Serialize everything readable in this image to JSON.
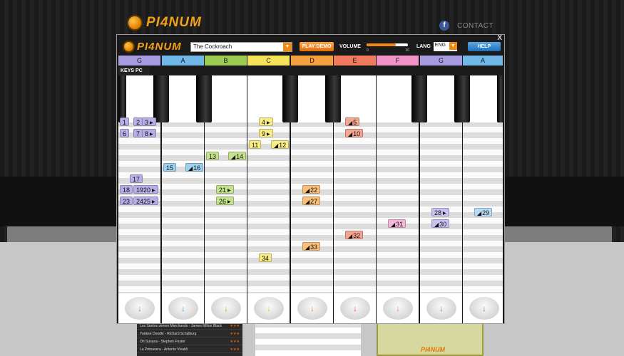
{
  "site": {
    "logo_text": "PI4NUM",
    "facebook_icon": "f",
    "contact": "CONTACT"
  },
  "app": {
    "logo_text": "PI4NUM",
    "close": "X",
    "song": "The Cockroach",
    "play_demo": "PLAY DEMO",
    "volume_label": "VOLUME",
    "volume_min": "0",
    "volume_max": "10",
    "volume_level": 0.7,
    "lang_label": "LANG",
    "lang_value": "ENG",
    "help": "HELP",
    "keys_pc": "KEYS PC",
    "dropdown_icon": "▼",
    "arrow_icon": "↓"
  },
  "notes": [
    {
      "label": "G",
      "color": "#a99be0",
      "arrow_color": "#8c7cd2"
    },
    {
      "label": "A",
      "color": "#6fb8e8",
      "arrow_color": "#4a9fe0"
    },
    {
      "label": "B",
      "color": "#9ccc52",
      "arrow_color": "#8abd3a"
    },
    {
      "label": "C",
      "color": "#f5e45a",
      "arrow_color": "#e8cc2a"
    },
    {
      "label": "D",
      "color": "#f5a040",
      "arrow_color": "#f08a10"
    },
    {
      "label": "E",
      "color": "#ef7a5e",
      "arrow_color": "#e8573a"
    },
    {
      "label": "F",
      "color": "#f293c8",
      "arrow_color": "#ec74b4"
    },
    {
      "label": "G",
      "color": "#a99be0",
      "arrow_color": "#8c7cd2"
    },
    {
      "label": "A",
      "color": "#6fb8e8",
      "arrow_color": "#4a9fe0"
    }
  ],
  "tags": [
    {
      "text": "1",
      "lane": 0,
      "row": 0,
      "color": "#b7b0e8"
    },
    {
      "text": "2",
      "lane": 0,
      "row": 0,
      "color": "#b7b0e8",
      "offset": 19
    },
    {
      "text": "3",
      "lane": 0,
      "row": 0,
      "color": "#b7b0e8",
      "offset": 31,
      "arrow": true
    },
    {
      "text": "6",
      "lane": 0,
      "row": 1,
      "color": "#b7b0e8"
    },
    {
      "text": "7",
      "lane": 0,
      "row": 1,
      "color": "#b7b0e8",
      "offset": 19
    },
    {
      "text": "8",
      "lane": 0,
      "row": 1,
      "color": "#b7b0e8",
      "offset": 31,
      "arrow": true
    },
    {
      "text": "17",
      "lane": 0,
      "row": 5,
      "color": "#b7b0e8",
      "offset": 14
    },
    {
      "text": "18",
      "lane": 0,
      "row": 6,
      "color": "#b7b0e8"
    },
    {
      "text": "1920",
      "lane": 0,
      "row": 6,
      "color": "#b7b0e8",
      "offset": 19,
      "arrow": true
    },
    {
      "text": "23",
      "lane": 0,
      "row": 7,
      "color": "#b7b0e8"
    },
    {
      "text": "2425",
      "lane": 0,
      "row": 7,
      "color": "#b7b0e8",
      "offset": 19,
      "arrow": true
    },
    {
      "text": "15",
      "lane": 1,
      "row": 4,
      "color": "#9ed0f0"
    },
    {
      "text": "16",
      "lane": 1,
      "row": 4,
      "color": "#9ed0f0",
      "offset": 31,
      "pre": true
    },
    {
      "text": "13",
      "lane": 2,
      "row": 3,
      "color": "#c4e28c"
    },
    {
      "text": "14",
      "lane": 2,
      "row": 3,
      "color": "#c4e28c",
      "offset": 31,
      "pre": true
    },
    {
      "text": "21",
      "lane": 2,
      "row": 6,
      "color": "#c4e28c",
      "offset": 14,
      "arrow": true
    },
    {
      "text": "26",
      "lane": 2,
      "row": 7,
      "color": "#c4e28c",
      "offset": 14,
      "arrow": true
    },
    {
      "text": "4",
      "lane": 3,
      "row": 0,
      "color": "#f7ec86",
      "offset": 14,
      "arrow": true
    },
    {
      "text": "9",
      "lane": 3,
      "row": 1,
      "color": "#f7ec86",
      "offset": 14,
      "arrow": true
    },
    {
      "text": "11",
      "lane": 3,
      "row": 2,
      "color": "#f7ec86"
    },
    {
      "text": "12",
      "lane": 3,
      "row": 2,
      "color": "#f7ec86",
      "offset": 31,
      "pre": true
    },
    {
      "text": "34",
      "lane": 3,
      "row": 12,
      "color": "#f7ec86",
      "offset": 14
    },
    {
      "text": "22",
      "lane": 4,
      "row": 6,
      "color": "#f8bf78",
      "offset": 14,
      "pre": true
    },
    {
      "text": "27",
      "lane": 4,
      "row": 7,
      "color": "#f8bf78",
      "offset": 14,
      "pre": true
    },
    {
      "text": "33",
      "lane": 4,
      "row": 11,
      "color": "#f8bf78",
      "offset": 14,
      "pre": true
    },
    {
      "text": "5",
      "lane": 5,
      "row": 0,
      "color": "#f4a490",
      "offset": 14,
      "pre": true
    },
    {
      "text": "10",
      "lane": 5,
      "row": 1,
      "color": "#f4a490",
      "offset": 14,
      "pre": true
    },
    {
      "text": "32",
      "lane": 5,
      "row": 10,
      "color": "#f4a490",
      "offset": 14,
      "pre": true
    },
    {
      "text": "31",
      "lane": 6,
      "row": 9,
      "color": "#f6b8da",
      "offset": 14,
      "pre": true
    },
    {
      "text": "28",
      "lane": 7,
      "row": 8,
      "color": "#c9c2ee",
      "offset": 14,
      "arrow": true
    },
    {
      "text": "30",
      "lane": 7,
      "row": 9,
      "color": "#c9c2ee",
      "offset": 14,
      "pre": true
    },
    {
      "text": "29",
      "lane": 8,
      "row": 8,
      "color": "#b8dcf4",
      "offset": 14,
      "pre": true
    }
  ],
  "bottom_list": [
    {
      "title": "Los Santos vienen Marchando",
      "author": "James Milton Black",
      "stars": "★★★"
    },
    {
      "title": "Yankee Doodle",
      "author": "Richard Schalburg",
      "stars": "★★★"
    },
    {
      "title": "Oh Susana",
      "author": "Stephen Foster",
      "stars": "★★★"
    },
    {
      "title": "La Primavera",
      "author": "Antonio Vivaldi",
      "stars": "★★★"
    }
  ],
  "bottom_info_logo": "PI4NUM"
}
